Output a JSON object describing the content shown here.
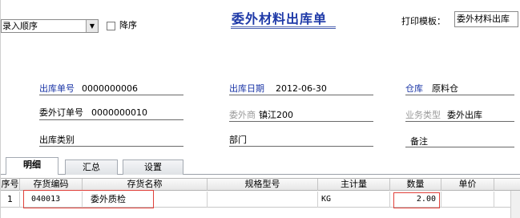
{
  "header": {
    "sort_value": "录入顺序",
    "desc_label": "降序",
    "title": "委外材料出库单",
    "template_label": "打印模板：",
    "template_value": "委外材料出库"
  },
  "fields": {
    "out_no_label": "出库单号",
    "out_no_value": "0000000006",
    "out_date_label": "出库日期",
    "out_date_value": "2012-06-30",
    "warehouse_label": "仓库",
    "warehouse_value": "原料仓",
    "order_no_label": "委外订单号",
    "order_no_value": "0000000010",
    "vendor_label": "委外商",
    "vendor_value": "镇江200",
    "biz_type_label": "业务类型",
    "biz_type_value": "委外出库",
    "out_type_label": "出库类别",
    "dept_label": "部门",
    "remark_label": "备注"
  },
  "tabs": [
    "明细",
    "汇总",
    "设置"
  ],
  "grid": {
    "columns": [
      "序号",
      "存货编码",
      "存货名称",
      "规格型号",
      "主计量",
      "数量",
      "单价"
    ],
    "rows": [
      [
        "1",
        "040013",
        "委外质检",
        "",
        "KG",
        "2.00",
        ""
      ]
    ]
  },
  "colors": {
    "title": "#1f3aa8",
    "required_label": "#1a35a6",
    "highlight": "#e0403a"
  }
}
